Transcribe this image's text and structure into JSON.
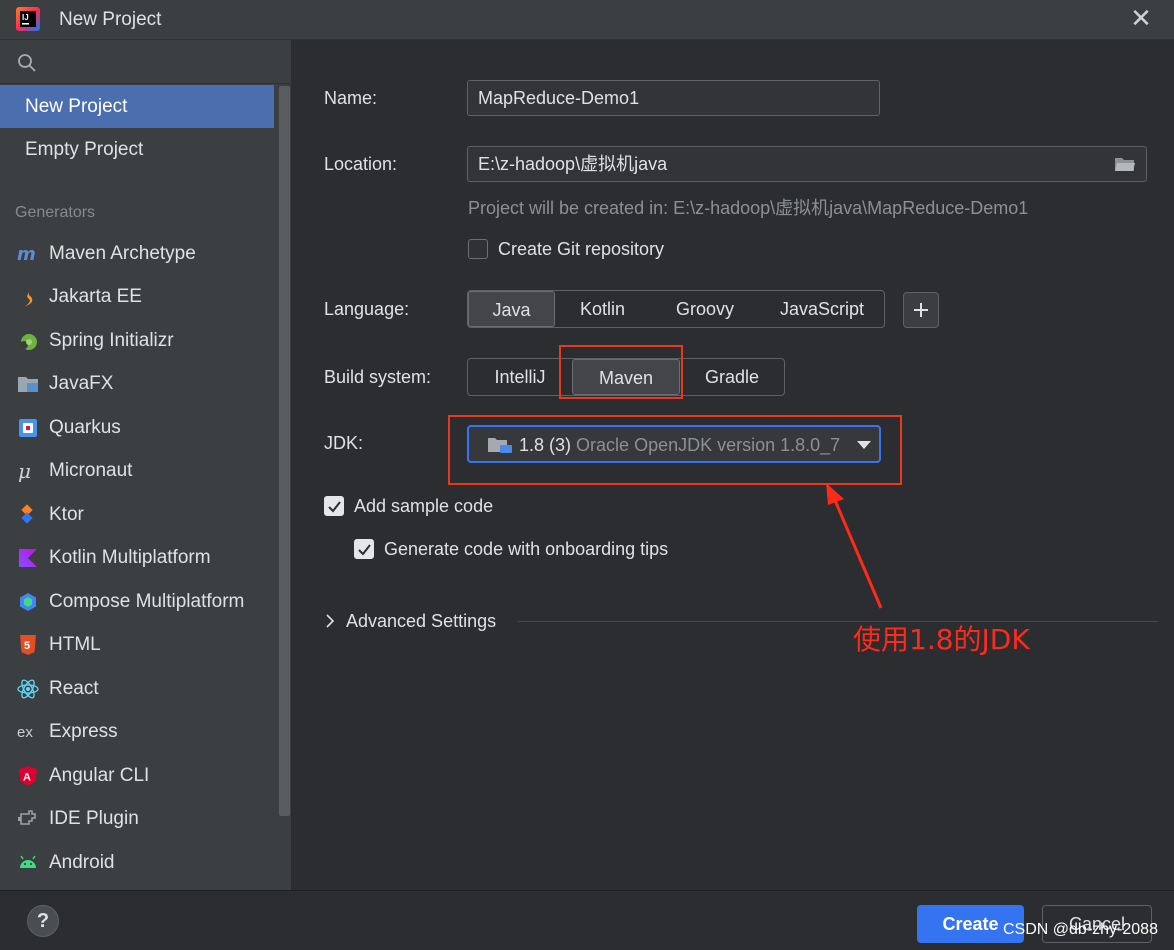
{
  "window": {
    "title": "New Project",
    "close_glyph": "✕"
  },
  "sidebar": {
    "top_items": [
      {
        "label": "New Project",
        "selected": true
      },
      {
        "label": "Empty Project",
        "selected": false
      }
    ],
    "generators_heading": "Generators",
    "generators": [
      {
        "label": "Maven Archetype",
        "icon": "maven-icon"
      },
      {
        "label": "Jakarta EE",
        "icon": "jakarta-icon"
      },
      {
        "label": "Spring Initializr",
        "icon": "spring-icon"
      },
      {
        "label": "JavaFX",
        "icon": "javafx-icon"
      },
      {
        "label": "Quarkus",
        "icon": "quarkus-icon"
      },
      {
        "label": "Micronaut",
        "icon": "micronaut-icon"
      },
      {
        "label": "Ktor",
        "icon": "ktor-icon"
      },
      {
        "label": "Kotlin Multiplatform",
        "icon": "kotlin-icon"
      },
      {
        "label": "Compose Multiplatform",
        "icon": "compose-icon"
      },
      {
        "label": "HTML",
        "icon": "html5-icon"
      },
      {
        "label": "React",
        "icon": "react-icon"
      },
      {
        "label": "Express",
        "icon": "express-icon"
      },
      {
        "label": "Angular CLI",
        "icon": "angular-icon"
      },
      {
        "label": "IDE Plugin",
        "icon": "plugin-icon"
      },
      {
        "label": "Android",
        "icon": "android-icon"
      }
    ]
  },
  "form": {
    "name_label": "Name:",
    "name_value": "MapReduce-Demo1",
    "location_label": "Location:",
    "location_value": "E:\\z-hadoop\\虚拟机java",
    "location_hint": "Project will be created in: E:\\z-hadoop\\虚拟机java\\MapReduce-Demo1",
    "git_label": "Create Git repository",
    "git_checked": false,
    "language_label": "Language:",
    "languages": [
      "Java",
      "Kotlin",
      "Groovy",
      "JavaScript"
    ],
    "language_selected": "Java",
    "build_label": "Build system:",
    "build_systems": [
      "IntelliJ",
      "Maven",
      "Gradle"
    ],
    "build_selected": "Maven",
    "jdk_label": "JDK:",
    "jdk_version": "1.8 (3)",
    "jdk_desc": "Oracle OpenJDK version 1.8.0_7",
    "sample_label": "Add sample code",
    "sample_checked": true,
    "onboarding_label": "Generate code with onboarding tips",
    "onboarding_checked": true,
    "advanced_label": "Advanced Settings"
  },
  "annotation": {
    "text": "使用1.8的JDK",
    "color": "#ff2a1a"
  },
  "footer": {
    "help": "?",
    "create": "Create",
    "cancel": "Cancel",
    "watermark": "CSDN @db-zhy-2088"
  },
  "colors": {
    "accent": "#3574f0",
    "selection": "#4b6eaf",
    "annotation": "#e8391b"
  }
}
